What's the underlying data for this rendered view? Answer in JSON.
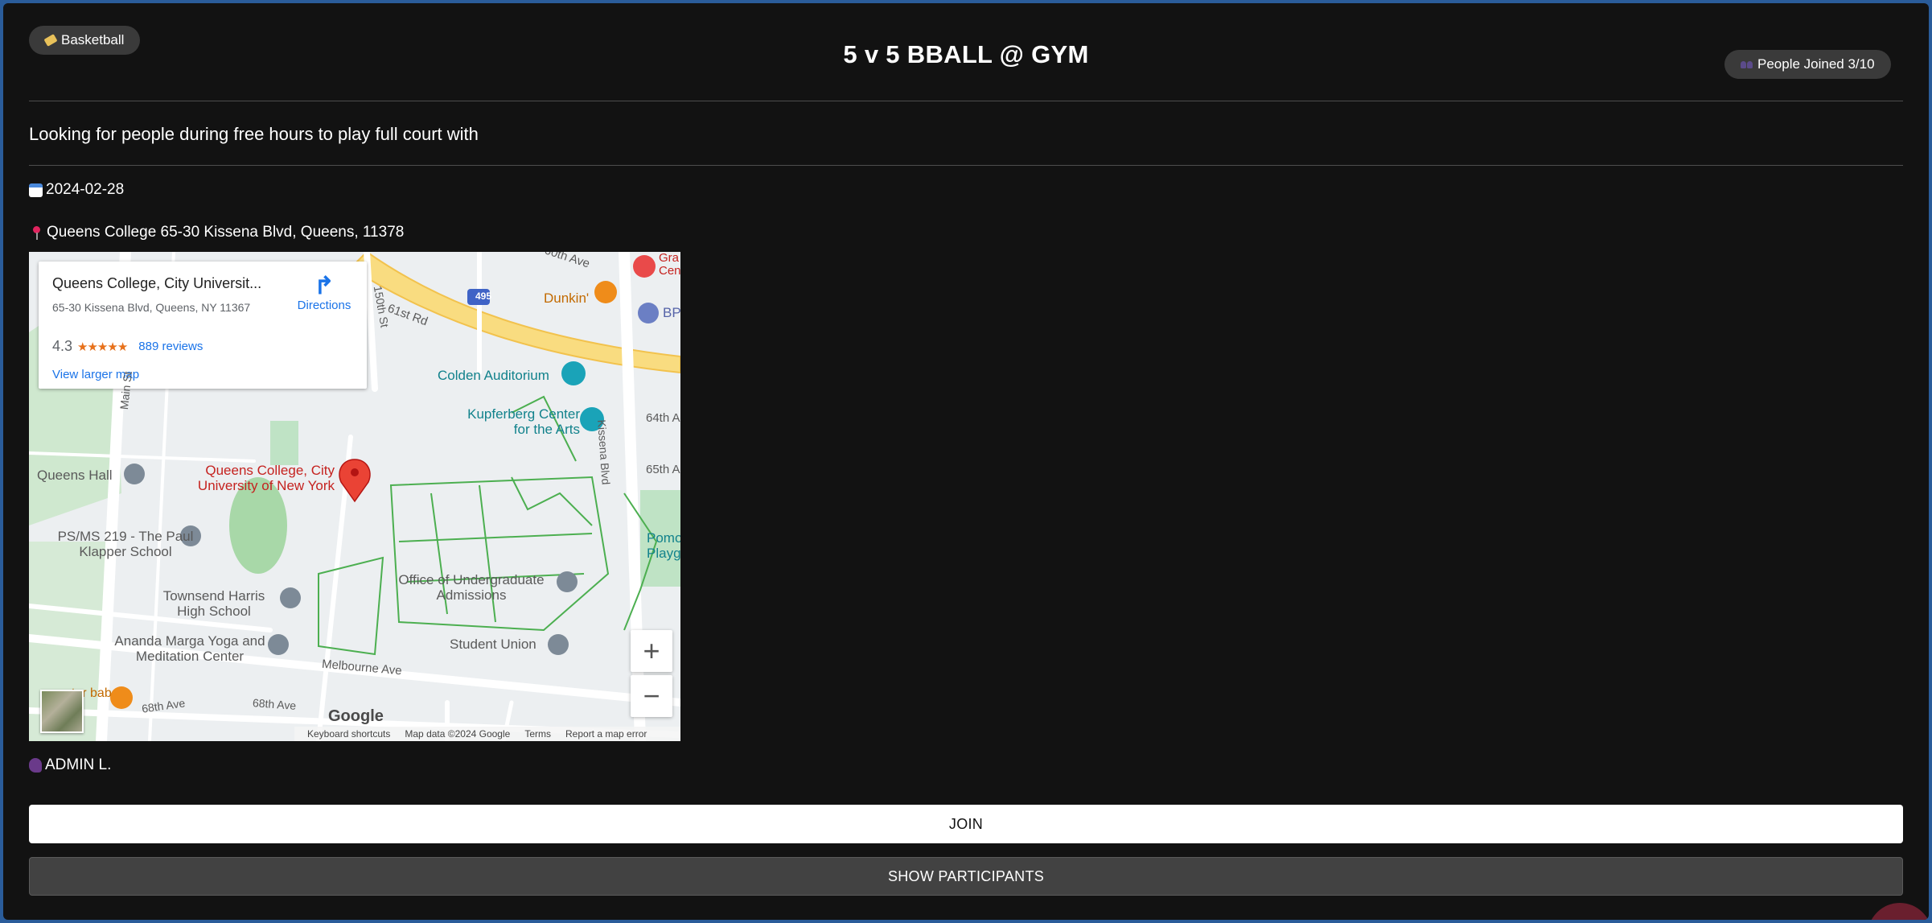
{
  "event": {
    "category_label": "Basketball",
    "category_icon": "tag-icon",
    "title": "5 v 5 BBALL @ GYM",
    "joined_label": "People Joined 3/10",
    "joined_icon": "people-icon",
    "description": "Looking for people during free hours to play full court with",
    "date": "2024-02-28",
    "date_icon": "calendar-icon",
    "location": "Queens College 65-30 Kissena Blvd, Queens, 11378",
    "location_icon": "pushpin-icon",
    "host": "ADMIN L.",
    "host_icon": "speaking-head-icon"
  },
  "map": {
    "place_name": "Queens College, City Universit...",
    "place_address": "65-30 Kissena Blvd, Queens, NY 11367",
    "rating": "4.3",
    "reviews": "889 reviews",
    "view_larger": "View larger map",
    "directions": "Directions",
    "marker_label": "Queens College, City University of New York",
    "labels": {
      "ave_60th": "60th Ave",
      "st_150th": "150th St",
      "rd_61st": "61st Rd",
      "dunkin": "Dunkin'",
      "colden": "Colden Auditorium",
      "kupferberg": "Kupferberg Center for the Arts",
      "kissena": "Kissena Blvd",
      "ave_64th": "64th A",
      "ave_65th": "65th A",
      "main_st": "Main St",
      "queens_hall": "Queens Hall",
      "psms": "PS/MS 219 - The Paul Klapper School",
      "office": "Office of Undergraduate Admissions",
      "townsend": "Townsend Harris High School",
      "ananda": "Ananda Marga Yoga and Meditation Center",
      "student_union": "Student Union",
      "melbourne": "Melbourne Ave",
      "ave_68th": "68th Ave",
      "ave_68th_2": "68th Ave",
      "pomo": "Pomo Playgr",
      "gra": "Gra Cen",
      "bp": "BP",
      "antar": "ntar bab",
      "shield": "495"
    },
    "zoom_in": "+",
    "zoom_out": "−",
    "google": "Google",
    "footer": {
      "shortcuts": "Keyboard shortcuts",
      "mapdata": "Map data ©2024 Google",
      "terms": "Terms",
      "report": "Report a map error"
    }
  },
  "actions": {
    "join": "JOIN",
    "show_participants": "SHOW PARTICIPANTS"
  },
  "colors": {
    "background": "#121212",
    "accent_blue": "#1a73e8",
    "marker_red": "#ea4335"
  }
}
